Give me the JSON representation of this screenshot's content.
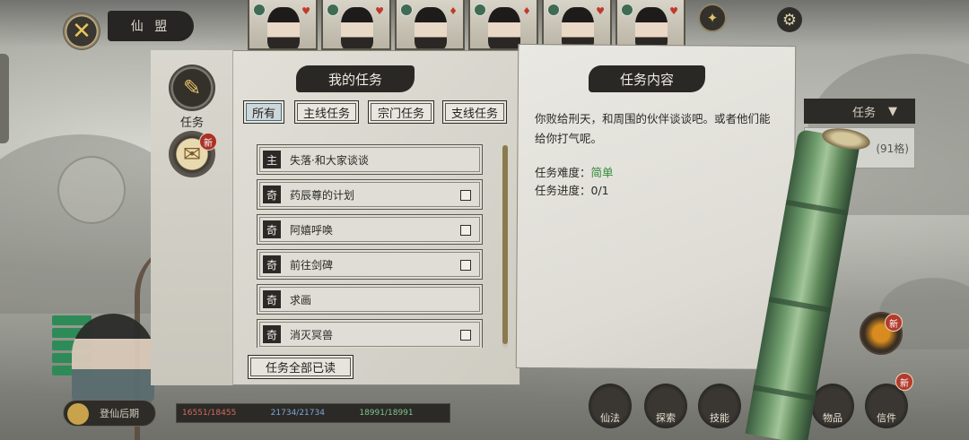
{
  "header": {
    "map_title": "仙 盟"
  },
  "party": {
    "portrait_count": 6,
    "suit_glyphs": [
      "♥",
      "♥",
      "♦",
      "♦",
      "♥",
      "♥"
    ]
  },
  "task_window": {
    "side_tabs": {
      "active_label": "任务",
      "new_badge": "新"
    },
    "title": "我的任务",
    "filters": [
      "所有",
      "主线任务",
      "宗门任务",
      "支线任务"
    ],
    "selected_filter": "所有",
    "tasks": [
      {
        "type": "主",
        "name": "失落·和大家谈谈",
        "checkbox": false
      },
      {
        "type": "奇",
        "name": "药辰尊的计划",
        "checkbox": true
      },
      {
        "type": "奇",
        "name": "阿嬉呼唤",
        "checkbox": true
      },
      {
        "type": "奇",
        "name": "前往剑碑",
        "checkbox": true
      },
      {
        "type": "奇",
        "name": "求画",
        "checkbox": false
      },
      {
        "type": "奇",
        "name": "消灭冥兽",
        "checkbox": true
      }
    ],
    "mark_all_read": "任务全部已读"
  },
  "detail": {
    "title": "任务内容",
    "description": "你败给刑天，和周围的伙伴谈谈吧。或者他们能给你打气呢。",
    "difficulty_label": "任务难度：",
    "difficulty_value": "简单",
    "progress_label": "任务进度：",
    "progress_value": "0/1"
  },
  "side_panel": {
    "task_label": "任务",
    "grid_text": "(91格)"
  },
  "hud": {
    "realm_button": "登仙后期",
    "hp": "16551/18455",
    "mp": "21734/21734",
    "sp": "18991/18991",
    "bottom_buttons": [
      "仙法",
      "探索",
      "技能",
      "物品",
      "信件"
    ],
    "bottom_new_badge": "新",
    "right_new_badge": "新"
  },
  "colors": {
    "ink": "#2a2825",
    "paper": "#e4e2da",
    "difficulty_easy": "#2e8b3a",
    "active_filter_border": "#3a6d86"
  }
}
